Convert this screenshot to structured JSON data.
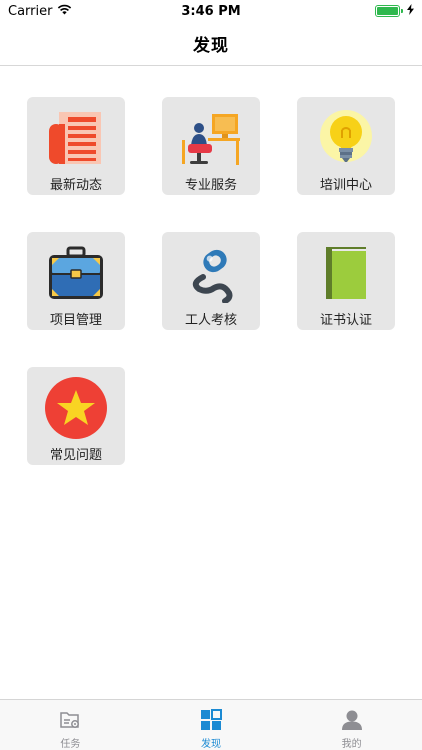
{
  "status_bar": {
    "carrier": "Carrier",
    "time": "3:46 PM",
    "battery_level": 1.0,
    "battery_color": "#2fb84e"
  },
  "nav": {
    "title": "发现"
  },
  "tiles": [
    {
      "label": "最新动态",
      "icon": "newspaper-icon"
    },
    {
      "label": "专业服务",
      "icon": "workstation-icon"
    },
    {
      "label": "培训中心",
      "icon": "lightbulb-icon"
    },
    {
      "label": "项目管理",
      "icon": "briefcase-icon"
    },
    {
      "label": "工人考核",
      "icon": "chain-link-icon"
    },
    {
      "label": "证书认证",
      "icon": "certificate-book-icon"
    },
    {
      "label": "常见问题",
      "icon": "star-badge-icon"
    }
  ],
  "tab_bar": {
    "active_color": "#1b8ad3",
    "inactive_color": "#8e8e93",
    "tabs": [
      {
        "label": "任务",
        "icon": "task-folder-icon",
        "active": false
      },
      {
        "label": "发现",
        "icon": "grid-discover-icon",
        "active": true
      },
      {
        "label": "我的",
        "icon": "person-icon",
        "active": false
      }
    ]
  }
}
